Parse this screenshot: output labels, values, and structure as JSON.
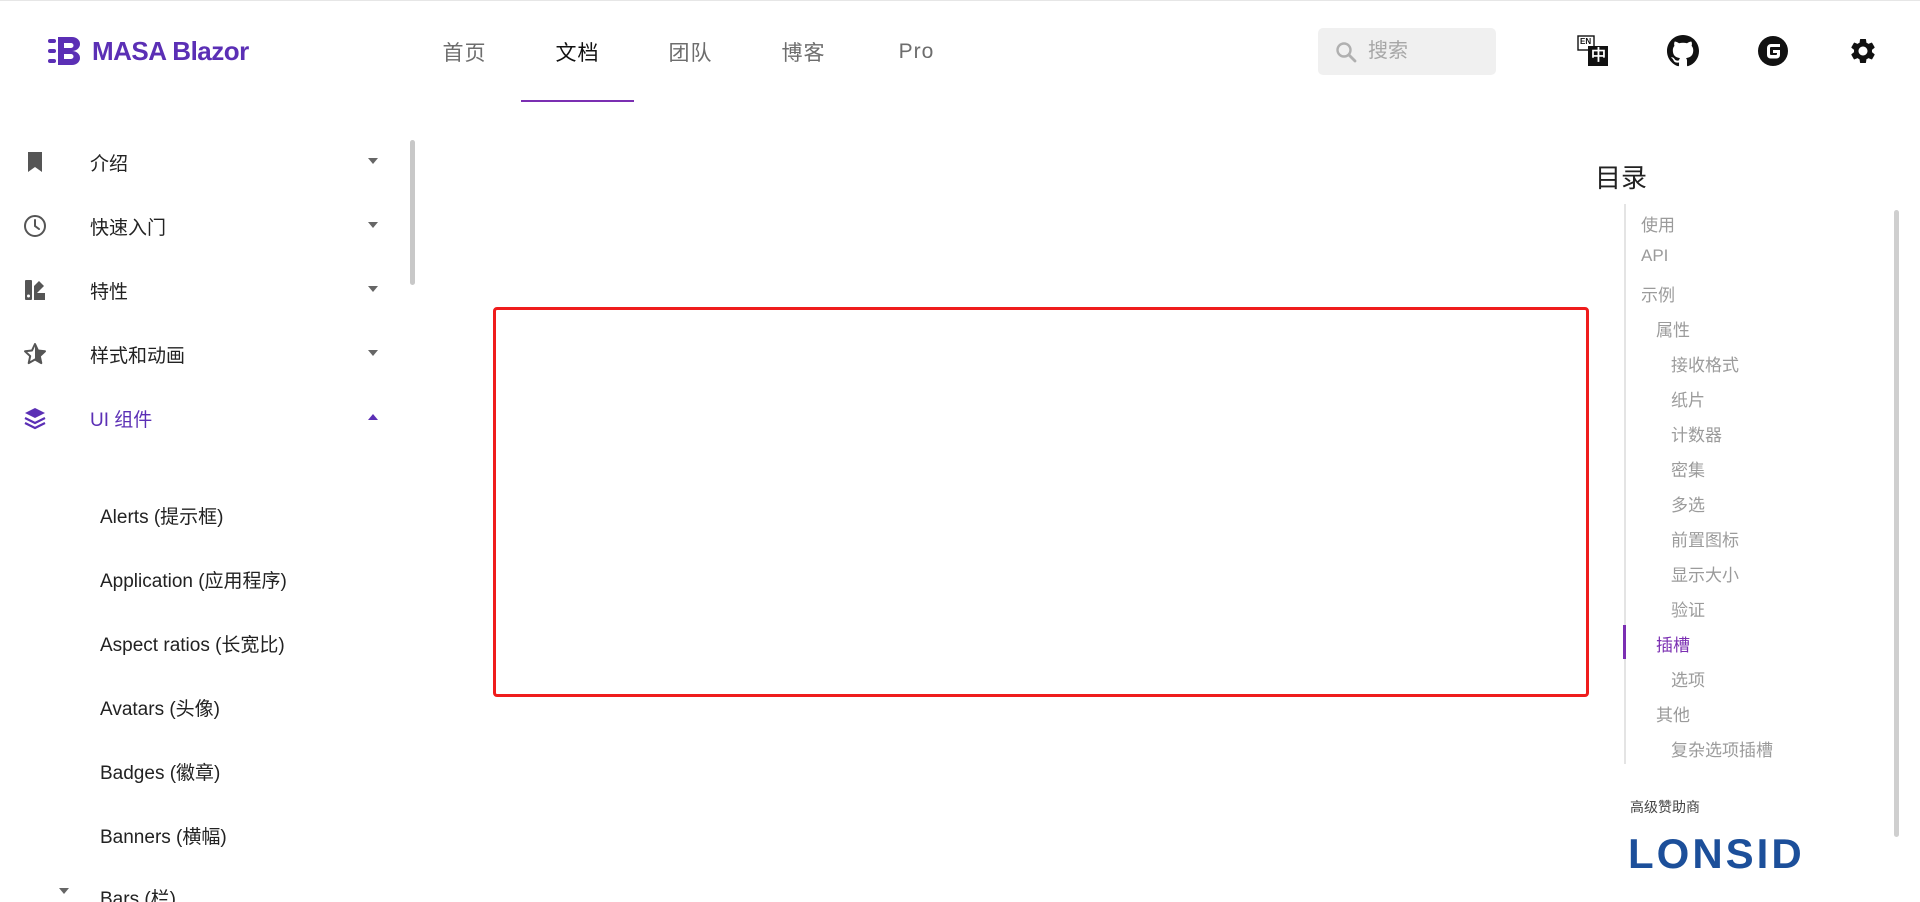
{
  "header": {
    "brand": "MASA Blazor",
    "nav": [
      {
        "label": "首页",
        "active": false
      },
      {
        "label": "文档",
        "active": true
      },
      {
        "label": "团队",
        "active": false
      },
      {
        "label": "博客",
        "active": false
      },
      {
        "label": "Pro",
        "active": false
      }
    ],
    "search_placeholder": "搜索",
    "icons": [
      "translate-icon",
      "github-icon",
      "gitee-icon",
      "settings-icon"
    ],
    "translate_badge_top": "EN",
    "translate_badge_bottom": "中"
  },
  "sidebar": {
    "groups": [
      {
        "label": "介绍",
        "icon": "bookmark-icon",
        "open": false
      },
      {
        "label": "快速入门",
        "icon": "clock-icon",
        "open": false
      },
      {
        "label": "特性",
        "icon": "palette-icon",
        "open": false
      },
      {
        "label": "样式和动画",
        "icon": "star-icon",
        "open": false
      },
      {
        "label": "UI 组件",
        "icon": "layers-icon",
        "open": true
      }
    ],
    "ui_components": [
      "Alerts (提示框)",
      "Application (应用程序)",
      "Aspect ratios (长宽比)",
      "Avatars (头像)",
      "Badges (徽章)",
      "Banners (横幅)",
      "Bars (栏)"
    ]
  },
  "toc": {
    "title": "目录",
    "items": [
      {
        "label": "使用",
        "level": 0,
        "active": false
      },
      {
        "label": "API",
        "level": 0,
        "active": false
      },
      {
        "label": "示例",
        "level": 0,
        "active": false
      },
      {
        "label": "属性",
        "level": 1,
        "active": false
      },
      {
        "label": "接收格式",
        "level": 2,
        "active": false
      },
      {
        "label": "纸片",
        "level": 2,
        "active": false
      },
      {
        "label": "计数器",
        "level": 2,
        "active": false
      },
      {
        "label": "密集",
        "level": 2,
        "active": false
      },
      {
        "label": "多选",
        "level": 2,
        "active": false
      },
      {
        "label": "前置图标",
        "level": 2,
        "active": false
      },
      {
        "label": "显示大小",
        "level": 2,
        "active": false
      },
      {
        "label": "验证",
        "level": 2,
        "active": false
      },
      {
        "label": "插槽",
        "level": 1,
        "active": true
      },
      {
        "label": "选项",
        "level": 2,
        "active": false
      },
      {
        "label": "其他",
        "level": 1,
        "active": false
      },
      {
        "label": "复杂选项插槽",
        "level": 2,
        "active": false
      }
    ],
    "sponsor_label": "高级赞助商",
    "sponsor_name": "LONSID"
  },
  "colors": {
    "brand": "#5b2fb5",
    "accent": "#7b2fb2",
    "highlight_frame": "#ef1c1c"
  }
}
